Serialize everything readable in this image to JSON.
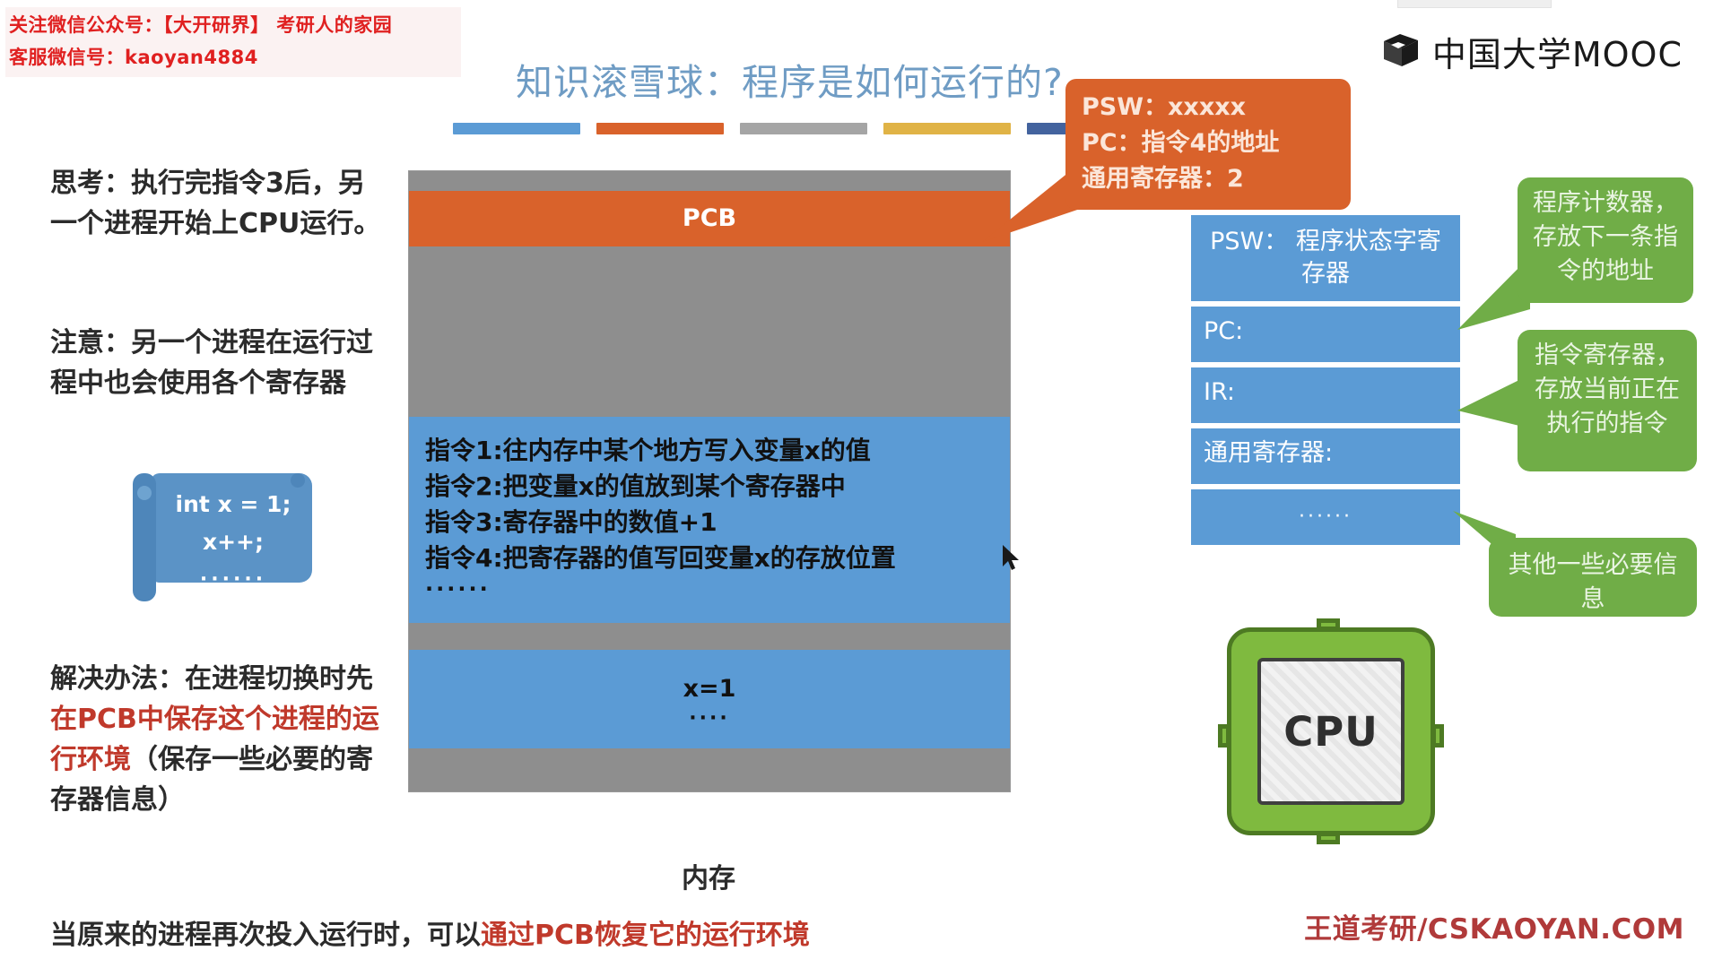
{
  "watermark": {
    "line1": "关注微信公众号：【大开研界】 考研人的家园",
    "line2": "客服微信号：kaoyan4884"
  },
  "logo": {
    "text": "中国大学MOOC",
    "icon": "mooc-cube-icon"
  },
  "title": {
    "text": "知识滚雪球：程序是如何运行的?",
    "color": "#6f9cc4",
    "bars": [
      "#5b9bd5",
      "#d9622b",
      "#a5a5a5",
      "#e0b346",
      "#43639e"
    ]
  },
  "left_notes": {
    "think": "思考：执行完指令3后，另一个进程开始上CPU运行。",
    "note": "注意：另一个进程在运行过程中也会使用各个寄存器",
    "solve_prefix": "解决办法：在进程切换时先",
    "solve_red": "在PCB中保存这个进程的运行环境",
    "solve_suffix": "（保存一些必要的寄存器信息）"
  },
  "code_scroll": {
    "line1": "int x = 1;",
    "line2": "x++;",
    "line3": "······"
  },
  "memory": {
    "caption": "内存",
    "pcb_label": "PCB",
    "instructions": [
      "指令1:往内存中某个地方写入变量x的值",
      "指令2:把变量x的值放到某个寄存器中",
      "指令3:寄存器中的数值+1",
      "指令4:把寄存器的值写回变量x的存放位置"
    ],
    "instructions_more": "······",
    "data_value": "x=1",
    "data_more": "····",
    "colors": {
      "gray": "#8e8e8e",
      "orange": "#d9622b",
      "blue": "#5b9bd5"
    }
  },
  "callout_orange": {
    "line1": "PSW：xxxxx",
    "line2": "PC：指令4的地址",
    "line3": "通用寄存器：2",
    "color": "#d9622b"
  },
  "registers": [
    {
      "name": "reg-psw",
      "label": "PSW： 程序状态字寄存器"
    },
    {
      "name": "reg-pc",
      "label": "PC:"
    },
    {
      "name": "reg-ir",
      "label": "IR:"
    },
    {
      "name": "reg-gr",
      "label": "通用寄存器:"
    },
    {
      "name": "reg-dots",
      "label": "······"
    }
  ],
  "green_callouts": [
    {
      "name": "pc-description",
      "text": "程序计数器，存放下一条指令的地址"
    },
    {
      "name": "ir-description",
      "text": "指令寄存器，存放当前正在执行的指令"
    },
    {
      "name": "other-description",
      "text": "其他一些必要信息"
    }
  ],
  "cpu": {
    "label": "CPU",
    "color": "#7fba3f"
  },
  "bottom": {
    "prefix": "当原来的进程再次投入运行时，可以",
    "red": "通过PCB恢复它的运行环境",
    "brand": "王道考研/CSKAOYAN.COM"
  }
}
